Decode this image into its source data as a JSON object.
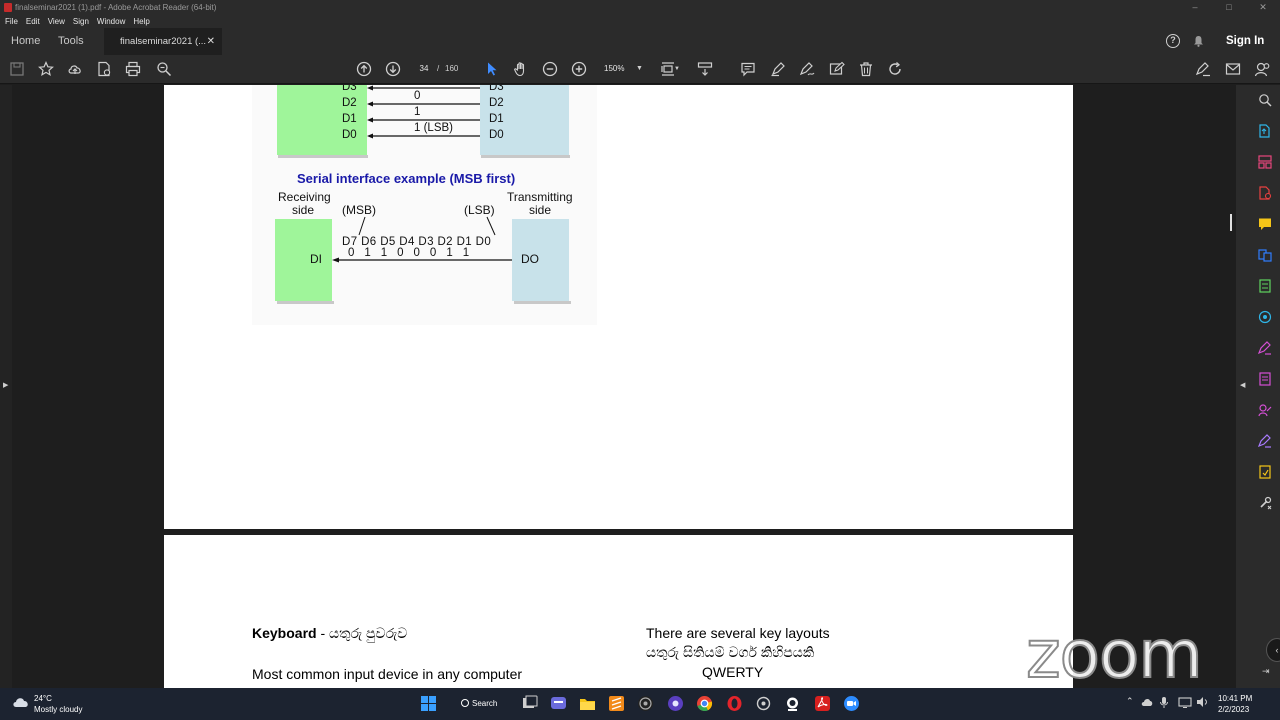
{
  "window": {
    "title": "finalseminar2021 (1).pdf - Adobe Acrobat Reader (64-bit)",
    "controls": [
      "–",
      "□",
      "✕"
    ]
  },
  "menu": [
    "File",
    "Edit",
    "View",
    "Sign",
    "Window",
    "Help"
  ],
  "tabs": {
    "home": "Home",
    "tools": "Tools",
    "document": "finalseminar2021 (...",
    "close": "✕"
  },
  "header": {
    "signin": "Sign In",
    "help": "?"
  },
  "toolbar": {
    "page_current": "34",
    "page_separator": "/",
    "page_total": "160",
    "zoom": "150%"
  },
  "diagram": {
    "parallel_left_labels": [
      "D3",
      "D2",
      "D1",
      "D0"
    ],
    "parallel_right_labels": [
      "D3",
      "D2",
      "D1",
      "D0"
    ],
    "parallel_values": [
      "0",
      "1",
      "1 (LSB)"
    ],
    "serial_title": "Serial interface example (MSB first)",
    "receiving_1": "Receiving",
    "receiving_2": "side",
    "transmitting_1": "Transmitting",
    "transmitting_2": "side",
    "msb": "(MSB)",
    "lsb": "(LSB)",
    "bits_labels": "D7 D6 D5 D4 D3 D2 D1 D0",
    "bits_values": "0  1  1  0  0  0  1  1",
    "di": "DI",
    "do": "DO"
  },
  "page2": {
    "heading_bold": "Keyboard",
    "heading_rest": " - යතුරු පුවරුව",
    "line1": "Most common input device in any computer",
    "right_line1": "There are several key layouts",
    "right_line2": "යතුරු සිතියම් වර්ග කිහිපයකි",
    "right_line3": "QWERTY"
  },
  "watermark": "zoom",
  "taskbar": {
    "temp": "24°C",
    "weather": "Mostly cloudy",
    "search": "Search",
    "time": "10:41 PM",
    "date": "2/2/2023"
  },
  "colors": {
    "receiver_box": "#9ff59a",
    "transmitter_box": "#c8e2ea",
    "serial_title": "#1a1aa8",
    "accent": "#3f8cff"
  }
}
